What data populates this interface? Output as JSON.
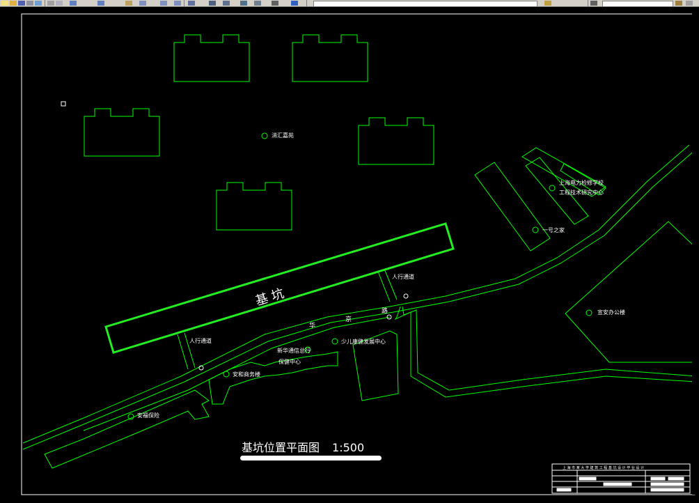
{
  "toolbar": {
    "buttons": [
      "new",
      "open",
      "save",
      "print",
      "preview",
      "cut",
      "copy",
      "paste",
      "match",
      "undo",
      "redo",
      "pan",
      "zoom",
      "zoom-window",
      "zoom-prev",
      "properties",
      "designcenter",
      "toolpalettes",
      "sheetset",
      "markup",
      "calculator",
      "help"
    ]
  },
  "colors": {
    "background": "#000000",
    "geometry": "#00ff00",
    "pit": "#22ee22",
    "text": "#ffffff",
    "border": "#ffffff"
  },
  "drawing": {
    "title": "基坑位置平面图",
    "scale": "1:500",
    "pit_label": "基  坑",
    "road_label": "华  京",
    "road_label_parts": [
      "华",
      "京",
      "路"
    ],
    "labels": {
      "pedestrian_1": "人行通道",
      "pedestrian_2": "人行通道",
      "building_a": "消汇嘉苑",
      "power_school_1": "上海电力检修学校",
      "power_school_2": "工程技术研究中心",
      "home": "一号之家",
      "office": "宣安办公楼",
      "bank": "新华通信总行",
      "center": "保健中心",
      "child": "少儿康健发展中心",
      "shop": "安和商务楼",
      "club": "安福保险"
    }
  },
  "title_block": {
    "header": "上 海 市 某 大 学 建 筑 工 程 基 坑 设 计 毕 业 设 计"
  }
}
